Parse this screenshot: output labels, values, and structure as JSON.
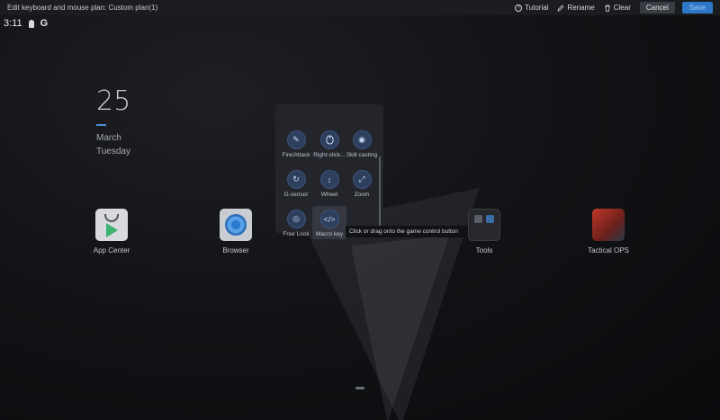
{
  "toolbar": {
    "title": "Edit keyboard and mouse plan: Custom plan(1)",
    "tutorial_label": "Tutorial",
    "rename_label": "Rename",
    "clear_label": "Clear",
    "cancel_label": "Cancel",
    "save_label": "Save"
  },
  "status": {
    "time": "3:11",
    "g_label": "G"
  },
  "clock": {
    "day": "25",
    "month": "March",
    "weekday": "Tuesday"
  },
  "apps": [
    {
      "label": "App Center"
    },
    {
      "label": "Browser"
    },
    {
      "label": "Tools"
    },
    {
      "label": "Tactical OPS"
    }
  ],
  "picker": {
    "items": [
      {
        "label": "Fire/Attack",
        "icon": "fire-attack-icon"
      },
      {
        "label": "Right-click...",
        "icon": "mouse-icon"
      },
      {
        "label": "Skill casting",
        "icon": "skill-target-icon"
      },
      {
        "label": "G-sensor",
        "icon": "gyro-icon"
      },
      {
        "label": "Wheel",
        "icon": "wheel-icon"
      },
      {
        "label": "Zoom",
        "icon": "zoom-icon"
      },
      {
        "label": "Free Look",
        "icon": "eye-icon"
      },
      {
        "label": "Macro key",
        "icon": "code-icon"
      }
    ]
  },
  "tooltip": "Click or drag onto the game control button",
  "colors": {
    "accent": "#2f78c7",
    "clock_bar": "#4c8fd6",
    "picker_bg": "#23252b"
  }
}
